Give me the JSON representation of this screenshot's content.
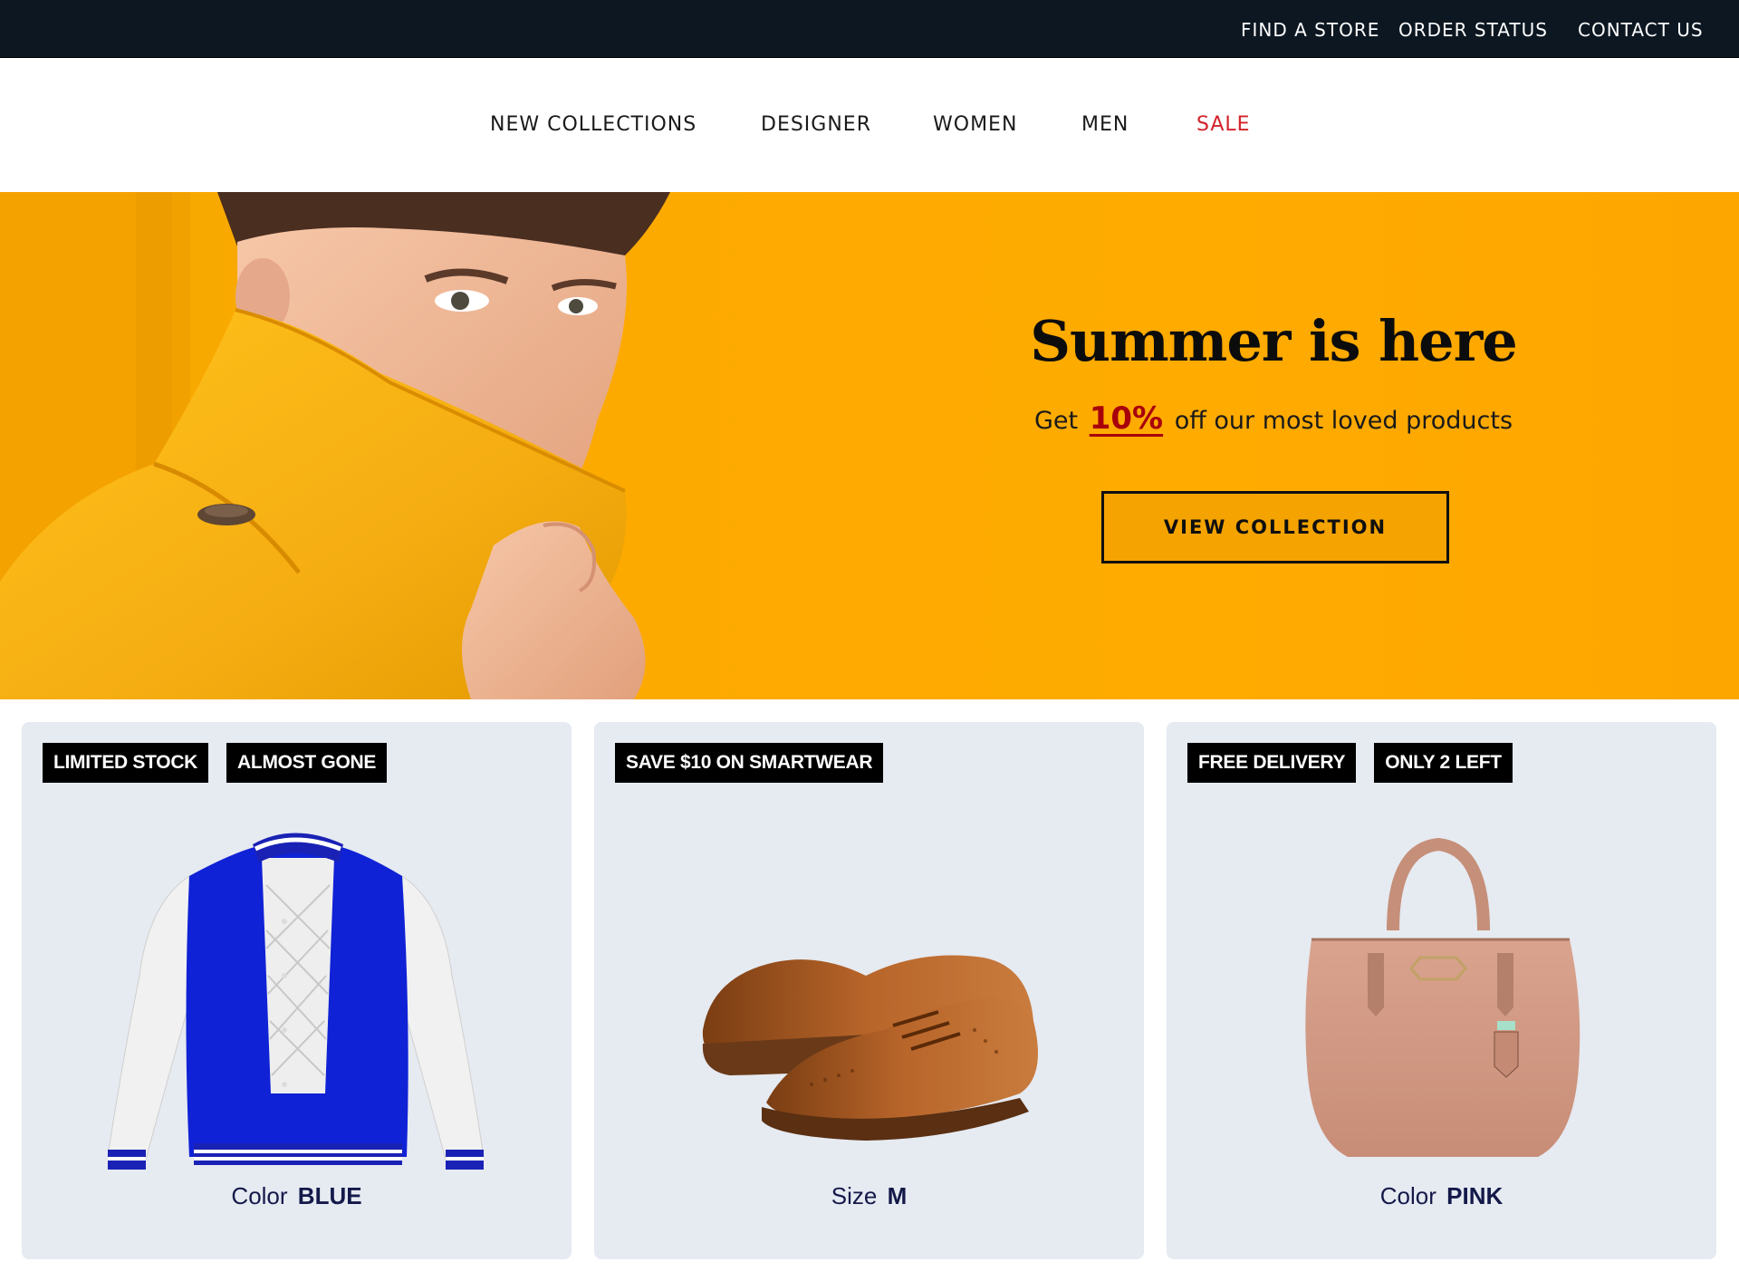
{
  "topbar": {
    "links": [
      "FIND A STORE",
      "ORDER STATUS",
      "CONTACT US"
    ]
  },
  "nav": {
    "items": [
      "NEW COLLECTIONS",
      "DESIGNER",
      "WOMEN",
      "MEN",
      "SALE"
    ],
    "sale_color": "#d2232a"
  },
  "hero": {
    "title": "Summer is here",
    "sub_prefix": "Get",
    "sub_highlight": "10%",
    "sub_suffix": "off our most loved products",
    "cta": "VIEW COLLECTION",
    "bg_color": "#ffab00",
    "highlight_color": "#a8000b"
  },
  "products": [
    {
      "badges": [
        "LIMITED STOCK",
        "ALMOST GONE"
      ],
      "attr_label": "Color",
      "attr_value": "BLUE",
      "image": "varsity-jacket"
    },
    {
      "badges": [
        "SAVE $10 ON SMARTWEAR"
      ],
      "attr_label": "Size",
      "attr_value": "M",
      "image": "brogue-shoes"
    },
    {
      "badges": [
        "FREE DELIVERY",
        "ONLY 2 LEFT"
      ],
      "attr_label": "Color",
      "attr_value": "PINK",
      "image": "handbag"
    }
  ]
}
